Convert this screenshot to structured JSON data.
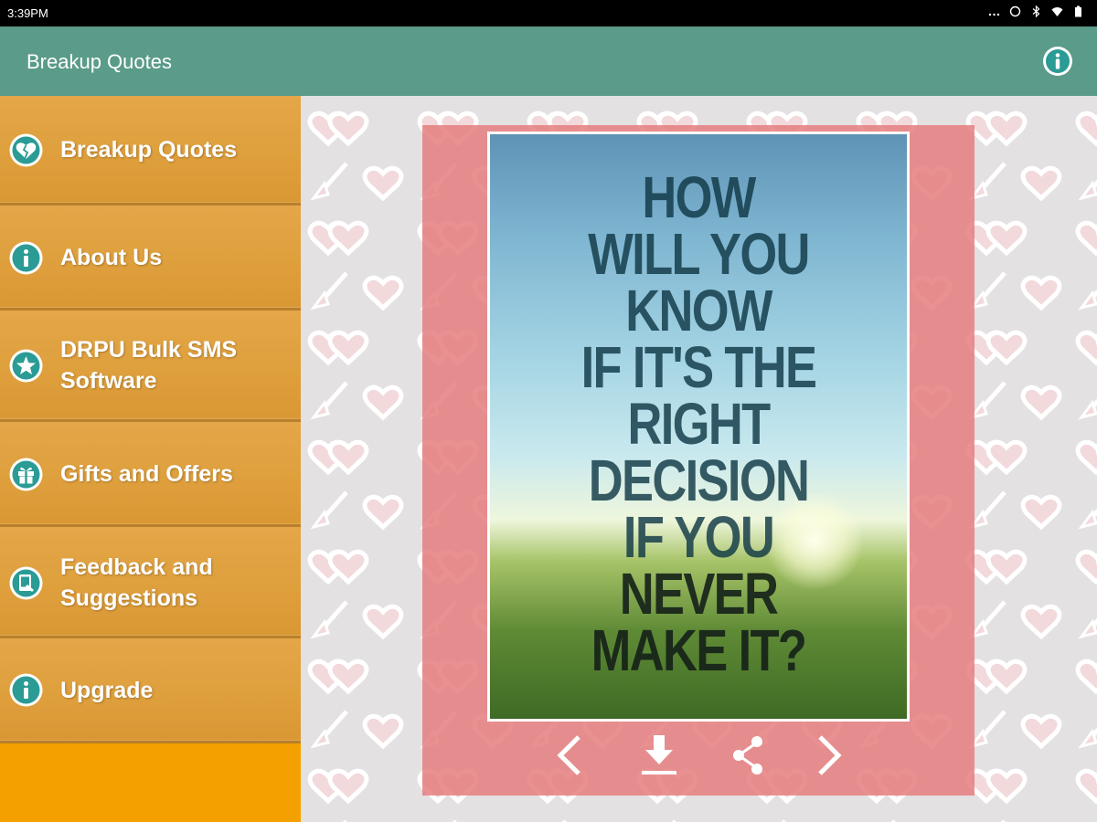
{
  "status_bar": {
    "time": "3:39PM"
  },
  "app_bar": {
    "title": "Breakup Quotes",
    "info_icon": "info-icon"
  },
  "menu": {
    "items": [
      {
        "label": "Breakup Quotes",
        "icon": "broken-heart-icon"
      },
      {
        "label": "About Us",
        "icon": "info-icon"
      },
      {
        "label": "DRPU Bulk SMS Software",
        "icon": "star-icon"
      },
      {
        "label": "Gifts and Offers",
        "icon": "gift-icon"
      },
      {
        "label": "Feedback and Suggestions",
        "icon": "feedback-icon"
      },
      {
        "label": "Upgrade",
        "icon": "info-icon"
      }
    ]
  },
  "quote": {
    "lines": [
      "HOW",
      "WILL YOU",
      "KNOW",
      "IF IT'S THE",
      "RIGHT",
      "DECISION",
      "IF YOU",
      "NEVER",
      "MAKE IT?"
    ]
  },
  "controls": {
    "previous": "chevron-left-icon",
    "download": "download-icon",
    "share": "share-icon",
    "next": "chevron-right-icon"
  },
  "colors": {
    "app_bar": "#5a9b89",
    "drawer_item": "#dfa03e",
    "drawer_bottom": "#f4a000",
    "frame": "#e57e7f",
    "icon_teal": "#2a9b95"
  }
}
